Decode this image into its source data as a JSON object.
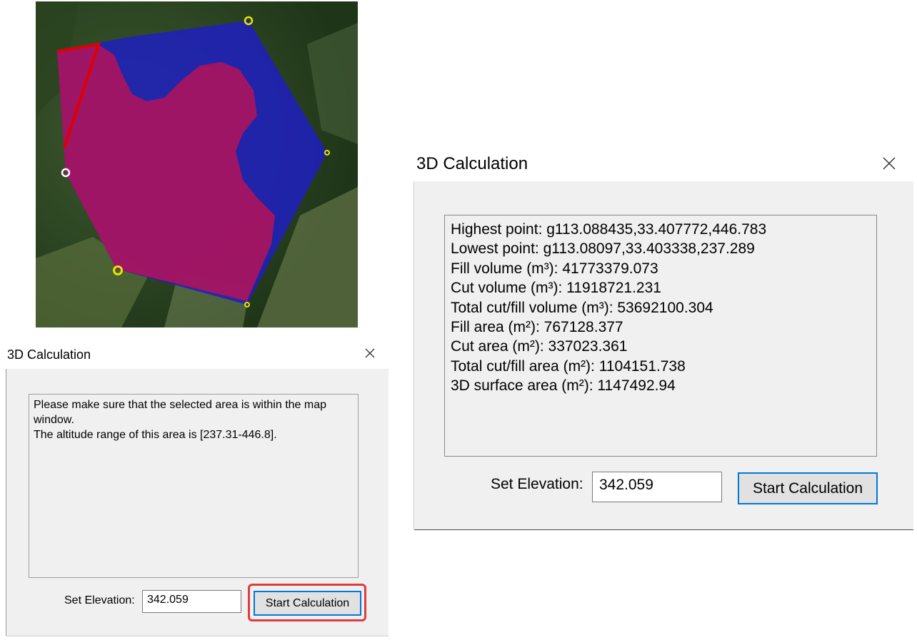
{
  "small_dialog": {
    "title": "3D Calculation",
    "message_lines": [
      "Please make sure that the selected area is within the map window.",
      "The altitude range of this area is [237.31-446.8]."
    ],
    "elevation_label": "Set Elevation:",
    "elevation_value": "342.059",
    "start_button": "Start Calculation"
  },
  "large_dialog": {
    "title": "3D Calculation",
    "results": [
      "Highest point: g113.088435,33.407772,446.783",
      "Lowest point: g113.08097,33.403338,237.289",
      "Fill volume (m³): 41773379.073",
      "Cut volume (m³): 11918721.231",
      "Total cut/fill volume (m³): 53692100.304",
      "Fill area (m²): 767128.377",
      "Cut area (m²): 337023.361",
      "Total cut/fill area (m²): 1104151.738",
      "3D surface area (m²): 1147492.94"
    ],
    "elevation_label": "Set Elevation:",
    "elevation_value": "342.059",
    "start_button": "Start Calculation"
  },
  "map": {
    "fill_color": "#b0135b",
    "cut_color": "#1f1fc0",
    "vertex_color": "#e6e600"
  }
}
